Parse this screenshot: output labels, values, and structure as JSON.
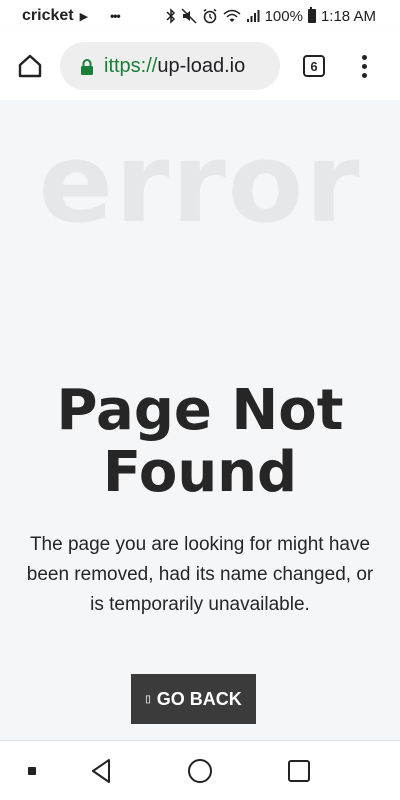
{
  "status_bar": {
    "carrier": "cricket",
    "battery": "100%",
    "time": "1:18 AM",
    "icons": [
      "play-icon",
      "more-dots-icon",
      "bluetooth-icon",
      "mute-icon",
      "alarm-icon",
      "wifi-icon",
      "signal-icon",
      "battery-icon"
    ]
  },
  "browser": {
    "url_scheme": "ittps://",
    "url_host": "up-load.io",
    "tab_count": "6",
    "colors": {
      "secure": "#188038",
      "toolbar": "#ffffff",
      "pill": "#eeeeee"
    }
  },
  "content": {
    "background_word": "error",
    "title_line1": "Page Not",
    "title_line2": "Found",
    "description": "The page you are looking for might have been removed, had its name changed, or is temporarily unavailable.",
    "button_icon": "▯",
    "button_label": "GO BACK",
    "colors": {
      "background": "#f5f6f8",
      "text": "#262626",
      "button": "#3b3b3b",
      "watermark": "#e6e7ea"
    }
  },
  "nav_bar": {
    "icons": [
      "assistant-dot-icon",
      "back-icon",
      "home-icon",
      "recents-icon"
    ]
  }
}
